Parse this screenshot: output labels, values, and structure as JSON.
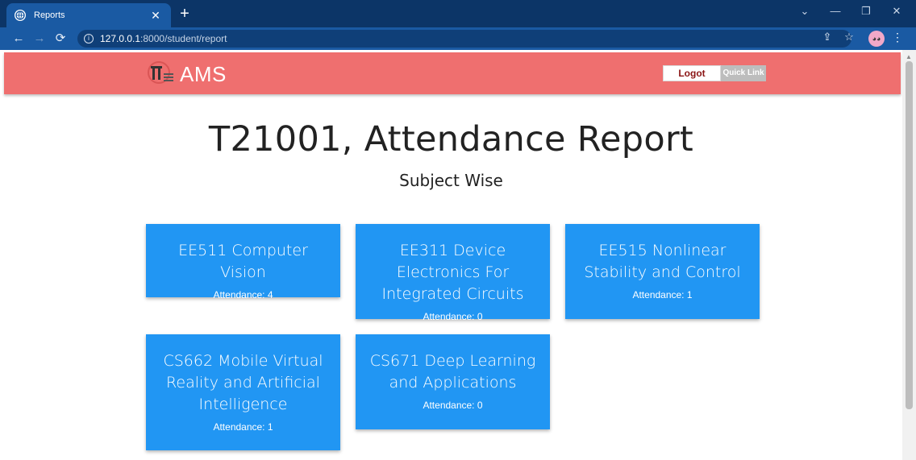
{
  "browser": {
    "tab_title": "Reports",
    "tab_close": "✕",
    "new_tab": "+",
    "url_host": "127.0.0.1",
    "url_path": ":8000/student/report",
    "win_chevron": "⌄",
    "win_minimize": "—",
    "win_restore": "❐",
    "win_close": "✕"
  },
  "header": {
    "brand": "AMS",
    "logout_label": "Logot",
    "quick_link_label": "Quick Link",
    "brand_color": "#ef6f6f"
  },
  "main": {
    "title": "T21001, Attendance Report",
    "subtitle": "Subject Wise",
    "card_color": "#2196f3",
    "subjects": [
      {
        "title": "EE511 Computer Vision",
        "attendance": "Attendance: 4"
      },
      {
        "title": "EE311 Device Electronics For Integrated Circuits",
        "attendance": "Attendance: 0"
      },
      {
        "title": "EE515 Nonlinear Stability and Control",
        "attendance": "Attendance: 1"
      },
      {
        "title": "CS662 Mobile Virtual Reality and Artificial Intelligence",
        "attendance": "Attendance: 1"
      },
      {
        "title": "CS671 Deep Learning and Applications",
        "attendance": "Attendance: 0"
      }
    ]
  },
  "icons": [
    "globe-icon",
    "back-icon",
    "forward-icon",
    "reload-icon",
    "info-icon",
    "share-icon",
    "star-icon",
    "profile-icon",
    "menu-icon",
    "logo-icon"
  ]
}
